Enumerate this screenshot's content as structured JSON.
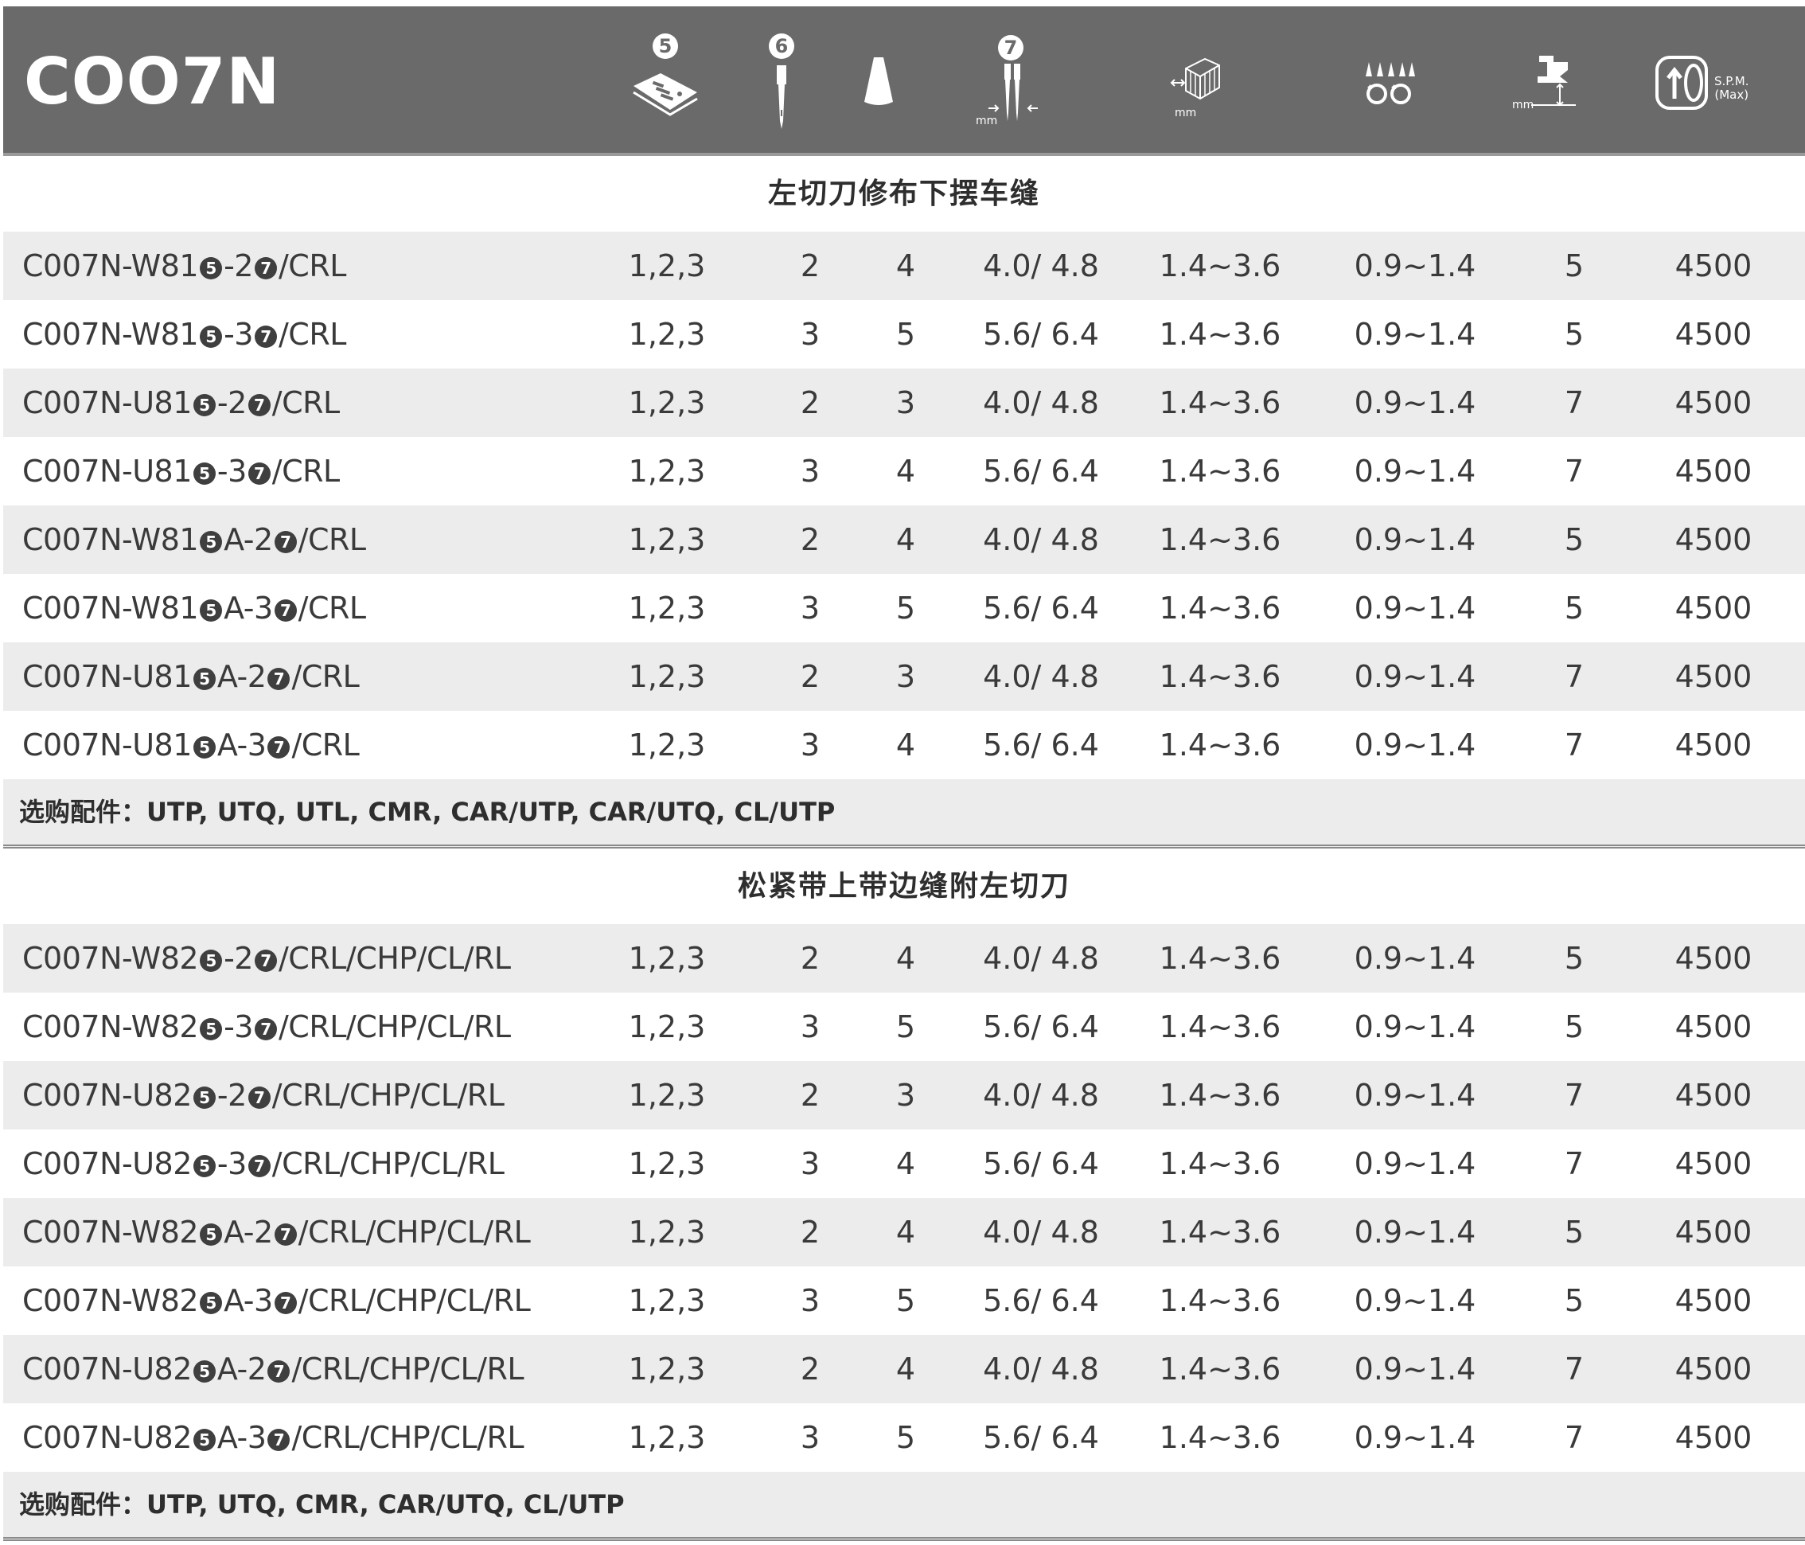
{
  "header": {
    "model": "COO7N",
    "columns": [
      {
        "icon": "needle-plate-icon",
        "badge": "5"
      },
      {
        "icon": "needle-icon",
        "badge": "6"
      },
      {
        "icon": "thread-cone-icon",
        "badge": ""
      },
      {
        "icon": "needle-gauge-icon",
        "badge": "7",
        "unit": "mm"
      },
      {
        "icon": "stitch-length-icon",
        "unit": "mm"
      },
      {
        "icon": "differential-feed-icon"
      },
      {
        "icon": "presser-foot-lift-icon",
        "unit": "mm"
      },
      {
        "icon": "speed-icon",
        "label1": "S.P.M.",
        "label2": "(Max)"
      }
    ]
  },
  "sections": [
    {
      "title": "左切刀修布下摆车缝",
      "rows": [
        {
          "p1": "C007N-W81",
          "p2": "-2",
          "p3": "/CRL",
          "c1": "1,2,3",
          "c2": "2",
          "c3": "4",
          "c4": "4.0/ 4.8",
          "c5": "1.4~3.6",
          "c6": "0.9~1.4",
          "c7": "5",
          "c8": "4500"
        },
        {
          "p1": "C007N-W81",
          "p2": "-3",
          "p3": "/CRL",
          "c1": "1,2,3",
          "c2": "3",
          "c3": "5",
          "c4": "5.6/ 6.4",
          "c5": "1.4~3.6",
          "c6": "0.9~1.4",
          "c7": "5",
          "c8": "4500"
        },
        {
          "p1": "C007N-U81",
          "p2": "-2",
          "p3": "/CRL",
          "c1": "1,2,3",
          "c2": "2",
          "c3": "3",
          "c4": "4.0/ 4.8",
          "c5": "1.4~3.6",
          "c6": "0.9~1.4",
          "c7": "7",
          "c8": "4500"
        },
        {
          "p1": "C007N-U81",
          "p2": "-3",
          "p3": "/CRL",
          "c1": "1,2,3",
          "c2": "3",
          "c3": "4",
          "c4": "5.6/ 6.4",
          "c5": "1.4~3.6",
          "c6": "0.9~1.4",
          "c7": "7",
          "c8": "4500"
        },
        {
          "p1": "C007N-W81",
          "p2": "A-2",
          "p3": "/CRL",
          "c1": "1,2,3",
          "c2": "2",
          "c3": "4",
          "c4": "4.0/ 4.8",
          "c5": "1.4~3.6",
          "c6": "0.9~1.4",
          "c7": "5",
          "c8": "4500"
        },
        {
          "p1": "C007N-W81",
          "p2": "A-3",
          "p3": "/CRL",
          "c1": "1,2,3",
          "c2": "3",
          "c3": "5",
          "c4": "5.6/ 6.4",
          "c5": "1.4~3.6",
          "c6": "0.9~1.4",
          "c7": "5",
          "c8": "4500"
        },
        {
          "p1": "C007N-U81",
          "p2": "A-2",
          "p3": "/CRL",
          "c1": "1,2,3",
          "c2": "2",
          "c3": "3",
          "c4": "4.0/ 4.8",
          "c5": "1.4~3.6",
          "c6": "0.9~1.4",
          "c7": "7",
          "c8": "4500"
        },
        {
          "p1": "C007N-U81",
          "p2": "A-3",
          "p3": "/CRL",
          "c1": "1,2,3",
          "c2": "3",
          "c3": "4",
          "c4": "5.6/ 6.4",
          "c5": "1.4~3.6",
          "c6": "0.9~1.4",
          "c7": "7",
          "c8": "4500"
        }
      ],
      "options": "选购配件：UTP, UTQ, UTL, CMR, CAR/UTP, CAR/UTQ, CL/UTP"
    },
    {
      "title": "松紧带上带边缝附左切刀",
      "rows": [
        {
          "p1": "C007N-W82",
          "p2": "-2",
          "p3": "/CRL/CHP/CL/RL",
          "c1": "1,2,3",
          "c2": "2",
          "c3": "4",
          "c4": "4.0/ 4.8",
          "c5": "1.4~3.6",
          "c6": "0.9~1.4",
          "c7": "5",
          "c8": "4500"
        },
        {
          "p1": "C007N-W82",
          "p2": "-3",
          "p3": "/CRL/CHP/CL/RL",
          "c1": "1,2,3",
          "c2": "3",
          "c3": "5",
          "c4": "5.6/ 6.4",
          "c5": "1.4~3.6",
          "c6": "0.9~1.4",
          "c7": "5",
          "c8": "4500"
        },
        {
          "p1": "C007N-U82",
          "p2": "-2",
          "p3": "/CRL/CHP/CL/RL",
          "c1": "1,2,3",
          "c2": "2",
          "c3": "3",
          "c4": "4.0/ 4.8",
          "c5": "1.4~3.6",
          "c6": "0.9~1.4",
          "c7": "7",
          "c8": "4500"
        },
        {
          "p1": "C007N-U82",
          "p2": "-3",
          "p3": "/CRL/CHP/CL/RL",
          "c1": "1,2,3",
          "c2": "3",
          "c3": "4",
          "c4": "5.6/ 6.4",
          "c5": "1.4~3.6",
          "c6": "0.9~1.4",
          "c7": "7",
          "c8": "4500"
        },
        {
          "p1": "C007N-W82",
          "p2": "A-2",
          "p3": "/CRL/CHP/CL/RL",
          "c1": "1,2,3",
          "c2": "2",
          "c3": "4",
          "c4": "4.0/ 4.8",
          "c5": "1.4~3.6",
          "c6": "0.9~1.4",
          "c7": "5",
          "c8": "4500"
        },
        {
          "p1": "C007N-W82",
          "p2": "A-3",
          "p3": "/CRL/CHP/CL/RL",
          "c1": "1,2,3",
          "c2": "3",
          "c3": "5",
          "c4": "5.6/ 6.4",
          "c5": "1.4~3.6",
          "c6": "0.9~1.4",
          "c7": "5",
          "c8": "4500"
        },
        {
          "p1": "C007N-U82",
          "p2": "A-2",
          "p3": "/CRL/CHP/CL/RL",
          "c1": "1,2,3",
          "c2": "2",
          "c3": "4",
          "c4": "4.0/ 4.8",
          "c5": "1.4~3.6",
          "c6": "0.9~1.4",
          "c7": "7",
          "c8": "4500"
        },
        {
          "p1": "C007N-U82",
          "p2": "A-3",
          "p3": "/CRL/CHP/CL/RL",
          "c1": "1,2,3",
          "c2": "3",
          "c3": "5",
          "c4": "5.6/ 6.4",
          "c5": "1.4~3.6",
          "c6": "0.9~1.4",
          "c7": "7",
          "c8": "4500"
        }
      ],
      "options": "选购配件：UTP, UTQ, CMR, CAR/UTQ, CL/UTP"
    }
  ],
  "placeholder_badges": {
    "b5": "5",
    "b7": "7"
  },
  "colors": {
    "header_bg": "#6a6a6a",
    "row_alt": "#ececec",
    "text": "#3a3a3a"
  }
}
